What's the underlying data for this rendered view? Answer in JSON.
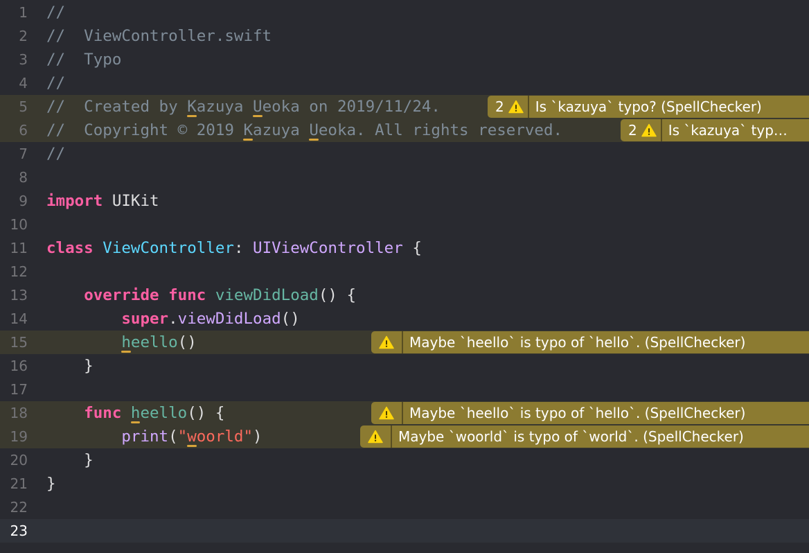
{
  "editor": {
    "lines": [
      {
        "num": "1",
        "tokens": [
          {
            "t": "//",
            "k": "comment"
          }
        ]
      },
      {
        "num": "2",
        "tokens": [
          {
            "t": "//  ViewController.swift",
            "k": "comment"
          }
        ]
      },
      {
        "num": "3",
        "tokens": [
          {
            "t": "//  Typo",
            "k": "comment"
          }
        ]
      },
      {
        "num": "4",
        "tokens": [
          {
            "t": "//",
            "k": "comment"
          }
        ]
      },
      {
        "num": "5",
        "warn": true,
        "tokens": [
          {
            "t": "//  Created by ",
            "k": "comment"
          },
          {
            "t": "Kazuya",
            "k": "comment",
            "typo": true
          },
          {
            "t": " ",
            "k": "comment"
          },
          {
            "t": "Ueoka",
            "k": "comment",
            "typo": true
          },
          {
            "t": " on 2019/11/24.",
            "k": "comment"
          }
        ],
        "badge": {
          "count": "2",
          "message": "Is `kazuya` typo? (SpellChecker)"
        }
      },
      {
        "num": "6",
        "warn": true,
        "tokens": [
          {
            "t": "//  Copyright © 2019 ",
            "k": "comment"
          },
          {
            "t": "Kazuya",
            "k": "comment",
            "typo": true
          },
          {
            "t": " ",
            "k": "comment"
          },
          {
            "t": "Ueoka",
            "k": "comment",
            "typo": true
          },
          {
            "t": ". All rights reserved.",
            "k": "comment"
          }
        ],
        "badge": {
          "count": "2",
          "message": "Is `kazuya` typ…"
        }
      },
      {
        "num": "7",
        "tokens": [
          {
            "t": "//",
            "k": "comment"
          }
        ]
      },
      {
        "num": "8",
        "tokens": []
      },
      {
        "num": "9",
        "tokens": [
          {
            "t": "import",
            "k": "kw"
          },
          {
            "t": " UIKit",
            "k": "plain"
          }
        ]
      },
      {
        "num": "10",
        "tokens": []
      },
      {
        "num": "11",
        "tokens": [
          {
            "t": "class",
            "k": "kw"
          },
          {
            "t": " ",
            "k": "plain"
          },
          {
            "t": "ViewController",
            "k": "type"
          },
          {
            "t": ": ",
            "k": "plain"
          },
          {
            "t": "UIViewController",
            "k": "sys"
          },
          {
            "t": " {",
            "k": "plain"
          }
        ]
      },
      {
        "num": "12",
        "tokens": []
      },
      {
        "num": "13",
        "tokens": [
          {
            "t": "    ",
            "k": "plain"
          },
          {
            "t": "override",
            "k": "kw"
          },
          {
            "t": " ",
            "k": "plain"
          },
          {
            "t": "func",
            "k": "kw"
          },
          {
            "t": " ",
            "k": "plain"
          },
          {
            "t": "viewDidLoad",
            "k": "proj"
          },
          {
            "t": "() {",
            "k": "plain"
          }
        ]
      },
      {
        "num": "14",
        "tokens": [
          {
            "t": "        ",
            "k": "plain"
          },
          {
            "t": "super",
            "k": "kw"
          },
          {
            "t": ".",
            "k": "plain"
          },
          {
            "t": "viewDidLoad",
            "k": "sys"
          },
          {
            "t": "()",
            "k": "plain"
          }
        ]
      },
      {
        "num": "15",
        "warn": true,
        "tokens": [
          {
            "t": "        ",
            "k": "plain"
          },
          {
            "t": "heello",
            "k": "proj",
            "typo": true
          },
          {
            "t": "()",
            "k": "plain"
          }
        ],
        "badge": {
          "count": "",
          "message": "Maybe `heello` is typo of `hello`. (SpellChecker)"
        }
      },
      {
        "num": "16",
        "tokens": [
          {
            "t": "    }",
            "k": "plain"
          }
        ]
      },
      {
        "num": "17",
        "tokens": []
      },
      {
        "num": "18",
        "warn": true,
        "tokens": [
          {
            "t": "    ",
            "k": "plain"
          },
          {
            "t": "func",
            "k": "kw"
          },
          {
            "t": " ",
            "k": "plain"
          },
          {
            "t": "heello",
            "k": "proj",
            "typo": true
          },
          {
            "t": "() {",
            "k": "plain"
          }
        ],
        "badge": {
          "count": "",
          "message": "Maybe `heello` is typo of `hello`. (SpellChecker)"
        }
      },
      {
        "num": "19",
        "warn": true,
        "tokens": [
          {
            "t": "        ",
            "k": "plain"
          },
          {
            "t": "print",
            "k": "sys"
          },
          {
            "t": "(",
            "k": "plain"
          },
          {
            "t": "\"",
            "k": "str"
          },
          {
            "t": "woorld",
            "k": "str",
            "typo": true
          },
          {
            "t": "\"",
            "k": "str"
          },
          {
            "t": ")",
            "k": "plain"
          }
        ],
        "badge": {
          "count": "",
          "message": "Maybe `woorld` is typo of `world`. (SpellChecker)"
        }
      },
      {
        "num": "20",
        "tokens": [
          {
            "t": "    }",
            "k": "plain"
          }
        ]
      },
      {
        "num": "21",
        "tokens": [
          {
            "t": "}",
            "k": "plain"
          }
        ]
      },
      {
        "num": "22",
        "tokens": []
      },
      {
        "num": "23",
        "current": true,
        "tokens": []
      }
    ]
  },
  "colors": {
    "background": "#292a30",
    "keyword": "#fc5fa3",
    "type": "#5dd8ff",
    "system": "#d0a8ff",
    "project": "#67b7a4",
    "string": "#fc6a5d",
    "comment": "#7f8c98",
    "warning_badge": "#8c7b31",
    "warning_line": "#3a392f"
  },
  "icons": {
    "warning": "warning-triangle-icon"
  }
}
